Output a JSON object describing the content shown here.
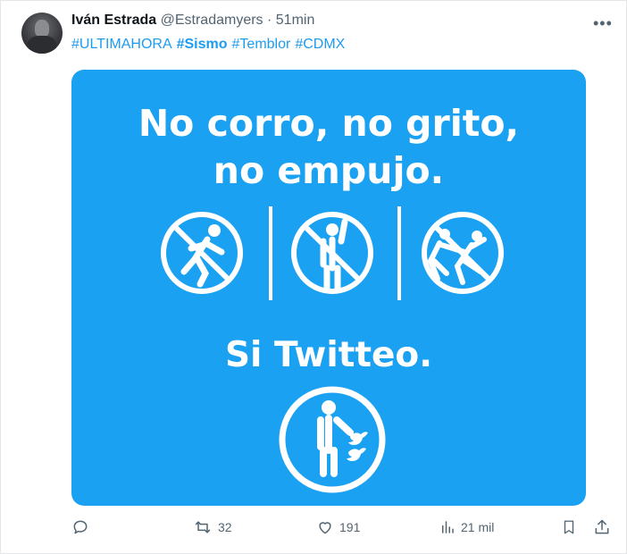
{
  "tweet": {
    "author_name": "Iván Estrada",
    "author_handle": "@Estradamyers",
    "separator": "·",
    "time": "51min",
    "hashtags": [
      "#ULTIMAHORA",
      "#Sismo",
      "#Temblor",
      "#CDMX"
    ],
    "more_icon": "more-horizontal-icon"
  },
  "media": {
    "line1": "No corro, no grito,",
    "line2": "no empujo.",
    "line3": "Si Twitteo.",
    "background": "#1aa1f2",
    "icons": [
      "no-running-icon",
      "no-shouting-icon",
      "no-pushing-icon",
      "person-with-twitter-birds-icon"
    ]
  },
  "actions": {
    "reply_icon": "reply-icon",
    "retweet_count": "32",
    "like_count": "191",
    "views_count": "21 mil",
    "bookmark_icon": "bookmark-icon",
    "share_icon": "share-icon"
  },
  "colors": {
    "accent": "#1d9bf0",
    "muted": "#536471"
  }
}
